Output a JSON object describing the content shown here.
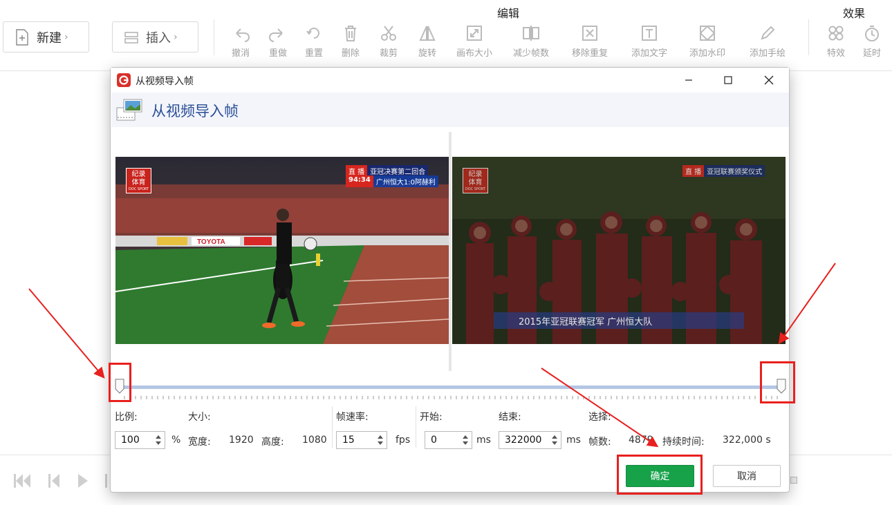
{
  "toolbar": {
    "new_label": "新建",
    "insert_label": "插入",
    "edit_group_label": "编辑",
    "effects_group_label": "效果",
    "tools": [
      {
        "label": "撤消",
        "icon": "undo-icon"
      },
      {
        "label": "重做",
        "icon": "redo-icon"
      },
      {
        "label": "重置",
        "icon": "reset-icon"
      },
      {
        "label": "删除",
        "icon": "delete-icon"
      },
      {
        "label": "裁剪",
        "icon": "crop-icon"
      },
      {
        "label": "旋转",
        "icon": "rotate-icon"
      },
      {
        "label": "画布大小",
        "icon": "canvas-size-icon"
      },
      {
        "label": "减少帧数",
        "icon": "reduce-frames-icon"
      },
      {
        "label": "移除重复",
        "icon": "remove-duplicates-icon"
      },
      {
        "label": "添加文字",
        "icon": "add-text-icon"
      },
      {
        "label": "添加水印",
        "icon": "add-watermark-icon"
      },
      {
        "label": "添加手绘",
        "icon": "add-drawing-icon"
      },
      {
        "label": "特效",
        "icon": "effects-icon"
      },
      {
        "label": "延时",
        "icon": "delay-icon"
      }
    ]
  },
  "dialog": {
    "window_title": "从视频导入帧",
    "header_title": "从视频导入帧",
    "preview_left": {
      "logo_line1": "纪录",
      "logo_line2": "体育",
      "logo_sub": "DOC SPORT",
      "live_tag": "直 播",
      "live_text": "亚冠决赛第二回合",
      "clock": "94:34",
      "score_text": "广州恒大1:0阿赫利"
    },
    "preview_right": {
      "logo_line1": "纪录",
      "logo_line2": "体育",
      "logo_sub": "DOC SPORT",
      "live_tag": "直 播",
      "live_text": "亚冠联赛颁奖仪式",
      "caption": "2015年亚冠联赛冠军   广州恒大队"
    },
    "fields": {
      "ratio_label": "比例:",
      "ratio_value": "100",
      "ratio_unit": "%",
      "size_label": "大小:",
      "width_label": "宽度:",
      "width_value": "1920",
      "height_label": "高度:",
      "height_value": "1080",
      "fps_label": "帧速率:",
      "fps_value": "15",
      "fps_unit": "fps",
      "start_label": "开始:",
      "start_value": "0",
      "start_unit": "ms",
      "end_label": "结束:",
      "end_value": "322000",
      "end_unit": "ms",
      "selection_label": "选择:",
      "frames_label": "帧数:",
      "frames_value": "4879",
      "duration_label": "持续时间:",
      "duration_value": "322,000 s"
    },
    "ok_label": "确定",
    "cancel_label": "取消"
  },
  "colors": {
    "ok_button": "#17a24a",
    "annotation": "#e8201e",
    "header_title": "#2a4e96",
    "slider_track": "#b4c6e4"
  }
}
